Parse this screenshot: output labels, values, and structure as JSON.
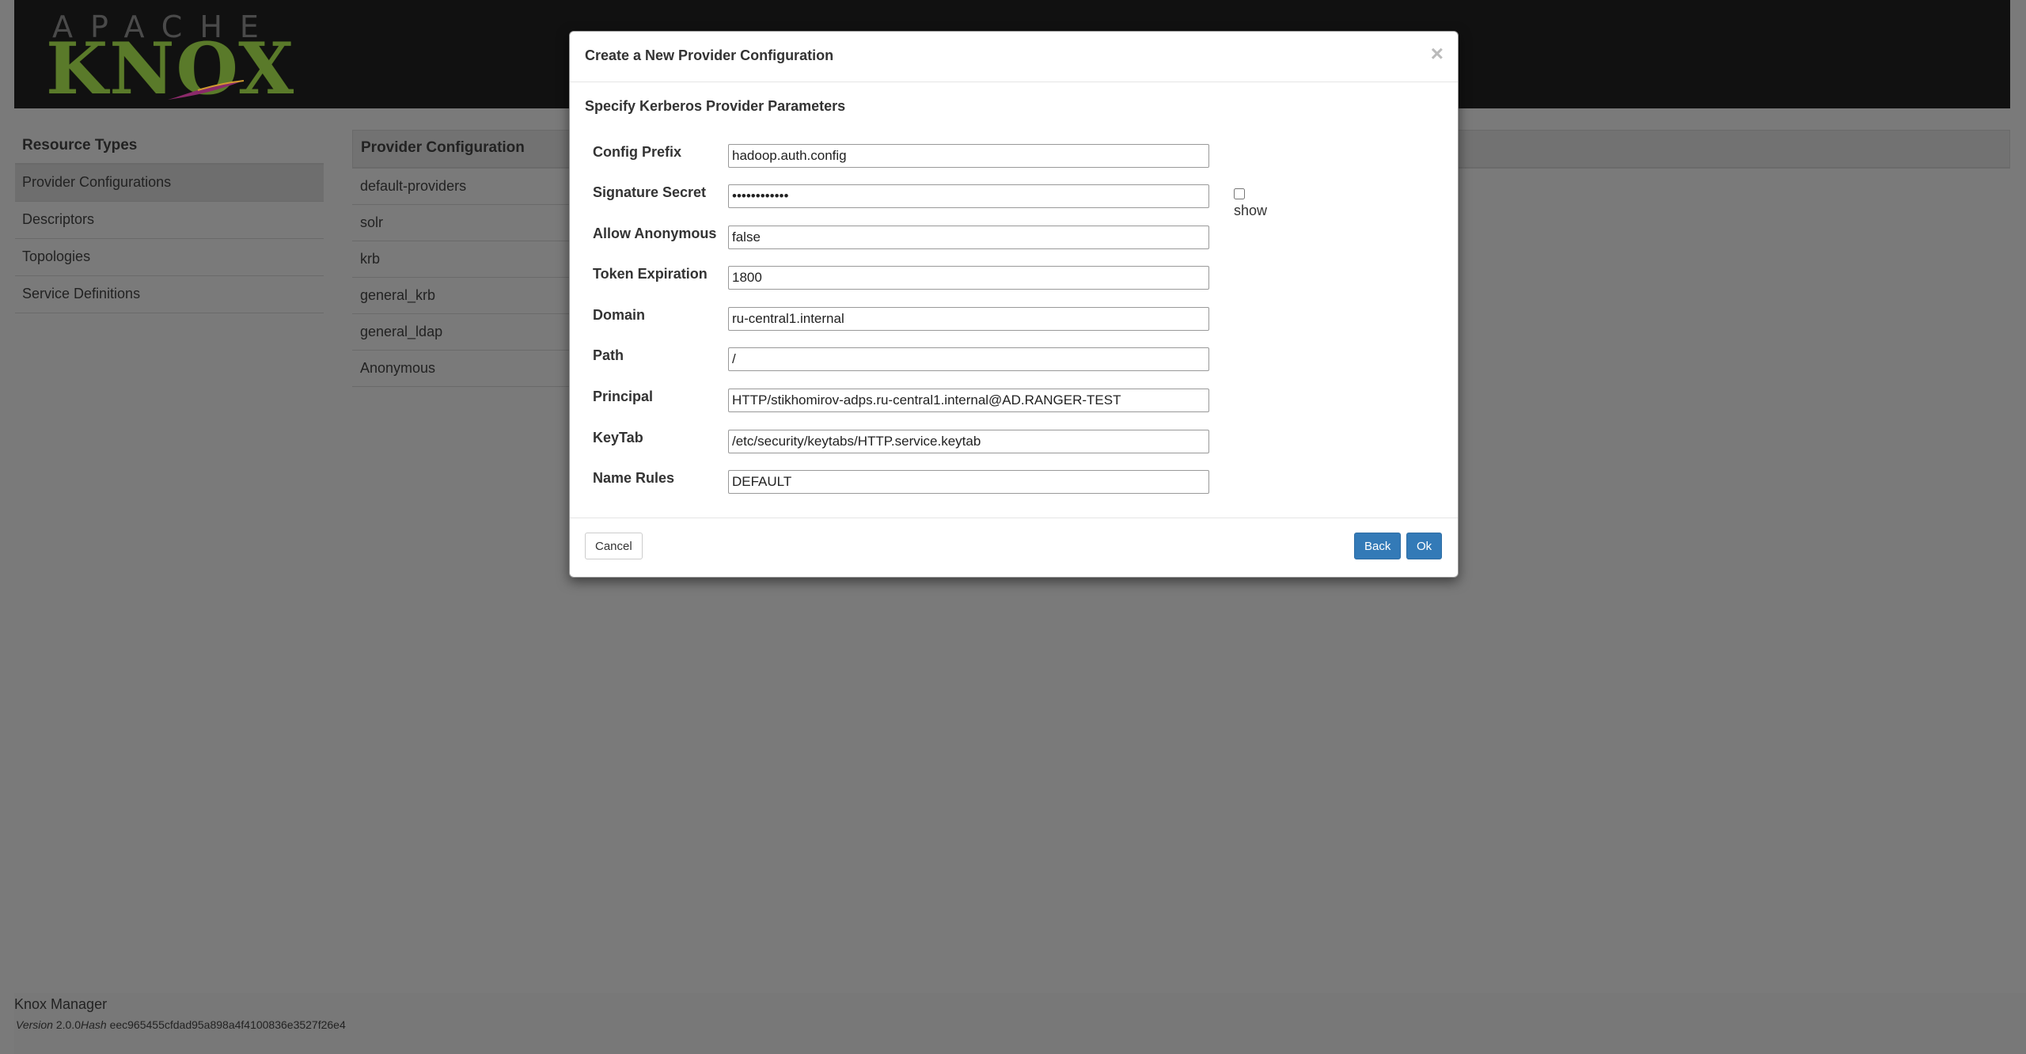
{
  "header": {
    "logo_top": "APACHE",
    "logo_main": "KNOX"
  },
  "nav": {
    "title": "Resource Types",
    "items": [
      {
        "label": "Provider Configurations"
      },
      {
        "label": "Descriptors"
      },
      {
        "label": "Topologies"
      },
      {
        "label": "Service Definitions"
      }
    ]
  },
  "providers": {
    "title": "Provider Configuration",
    "items": [
      {
        "label": "default-providers"
      },
      {
        "label": "solr"
      },
      {
        "label": "krb"
      },
      {
        "label": "general_krb"
      },
      {
        "label": "general_ldap"
      },
      {
        "label": "Anonymous"
      }
    ]
  },
  "modal": {
    "title": "Create a New Provider Configuration",
    "close": "×",
    "subtitle": "Specify Kerberos Provider Parameters",
    "fields": [
      {
        "label": "Config Prefix",
        "value": "hadoop.auth.config"
      },
      {
        "label": "Signature Secret",
        "value": "••••••••••••"
      },
      {
        "label": "Allow Anonymous",
        "value": "false"
      },
      {
        "label": "Token Expiration",
        "value": "1800"
      },
      {
        "label": "Domain",
        "value": "ru-central1.internal"
      },
      {
        "label": "Path",
        "value": "/"
      },
      {
        "label": "Principal",
        "value": "HTTP/stikhomirov-adps.ru-central1.internal@AD.RANGER-TEST"
      },
      {
        "label": "KeyTab",
        "value": "/etc/security/keytabs/HTTP.service.keytab"
      },
      {
        "label": "Name Rules",
        "value": "DEFAULT"
      }
    ],
    "show_label": "show",
    "cancel": "Cancel",
    "back": "Back",
    "ok": "Ok"
  },
  "footer": {
    "app_name": "Knox Manager",
    "version_label": "Version",
    "version": "2.0.0",
    "hash_label": "Hash",
    "hash": "eec965455cfdad95a898a4f4100836e3527f26e4"
  },
  "colors": {
    "primary_button": "#337ab7",
    "logo_green": "#5a7a2a"
  }
}
